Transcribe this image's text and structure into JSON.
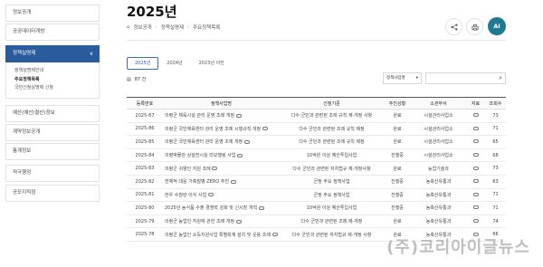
{
  "sidebar": {
    "items": [
      {
        "label": "정보공개"
      },
      {
        "label": "공공데이터개방"
      },
      {
        "label": "정책실명제"
      },
      {
        "label": "예산(예산/결산)정보"
      },
      {
        "label": "계약정보공개"
      },
      {
        "label": "통계정보"
      },
      {
        "label": "적극행정"
      },
      {
        "label": "공모지적점"
      }
    ],
    "sub_items": [
      {
        "label": "정책실명제안내"
      },
      {
        "label": "주요정책목록"
      },
      {
        "label": "국민신청실명제 신청"
      }
    ]
  },
  "header": {
    "title": "2025년",
    "breadcrumb": [
      "정보공개",
      "정책실명제",
      "주요정책목록"
    ],
    "ai_label": "AI"
  },
  "tabs": [
    "2025년",
    "2024년",
    "2023년 이전"
  ],
  "count_text": "87 건",
  "filter": {
    "select_label": "정책사업명"
  },
  "table": {
    "headers": [
      "등록번호",
      "정책사업명",
      "선정기준",
      "추진상황",
      "소관부서",
      "자료",
      "조회수"
    ],
    "rows": [
      {
        "no": "2025-87",
        "name": "의령군 체육시설 관리 운영 조례 개정",
        "criteria": "다수 군민과 관련된 조례 규칙 제·개정 사항",
        "status": "완료",
        "dept": "시설관리사업소",
        "views": "73"
      },
      {
        "no": "2025-86",
        "name": "의령군 국민체육센터 관리 운영 조례 시행규칙 개정",
        "criteria": "다수 군민과 관련된 조례 규칙 제정",
        "status": "완료",
        "dept": "시설관리사업소",
        "views": "71"
      },
      {
        "no": "2025-85",
        "name": "의령군 국민체육센터 관리 운영 조례 개정",
        "criteria": "다수 군민과 관련된 조례 규칙 제정",
        "status": "완료",
        "dept": "시설관리사업소",
        "views": "65"
      },
      {
        "no": "2025-84",
        "name": "의령박물관 상설전시실 리모델링 사업",
        "criteria": "10억원 이상 예산투입사업",
        "status": "진행중",
        "dept": "시설관리사업소",
        "views": "68"
      },
      {
        "no": "2025-83",
        "name": "의령군 귀향인 지원 조례",
        "criteria": "다수 군민과 관련된 자치법규 제·개정사항",
        "status": "완료",
        "dept": "농업기술과",
        "views": "73"
      },
      {
        "no": "2025-82",
        "name": "전체적 대응 가축질병 ZERO 추진",
        "criteria": "군정 주요 정책사업",
        "status": "진행중",
        "dept": "농축산유통과",
        "views": "63"
      },
      {
        "no": "2025-81",
        "name": "한우 수정란 이식 사업",
        "criteria": "군정 주요 정책사업",
        "status": "진행중",
        "dept": "농축산유통과",
        "views": "71"
      },
      {
        "no": "2025-80",
        "name": "2025년 농식품 수출 경쟁력 강화 및 신시장 개척",
        "criteria": "10억원 이상 예산투입사업",
        "status": "진행중",
        "dept": "농축산유통과",
        "views": "71"
      },
      {
        "no": "2025-79",
        "name": "의령군 농업인 지원에 관한 조례 개정",
        "criteria": "다수 군민과 관련된 조례 제·개정",
        "status": "완료",
        "dept": "농축산유통과",
        "views": "74"
      },
      {
        "no": "2025-78",
        "name": "의령군 농업인 소득지원사업 특별회계 설치 및 운용 조례",
        "criteria": "다수 군민과 관련된 자치법규 제·개정 사항",
        "status": "완료",
        "dept": "농축산유통과",
        "views": "66"
      }
    ]
  },
  "watermark": "(주)코리아이글뉴스",
  "colors": {
    "accent": "#2a5b9c",
    "ai_button": "#1d7c8f"
  }
}
